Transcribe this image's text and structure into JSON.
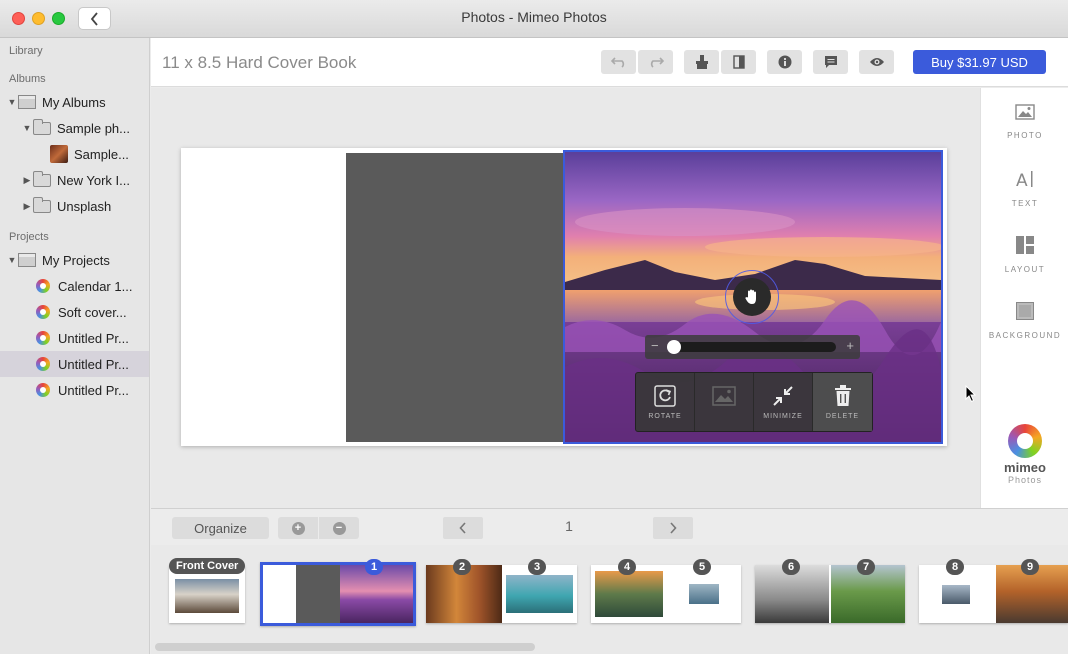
{
  "window": {
    "title": "Photos - Mimeo Photos"
  },
  "sidebar": {
    "library_heading": "Library",
    "albums_heading": "Albums",
    "albums": [
      {
        "label": "My Albums"
      },
      {
        "label": "Sample ph..."
      },
      {
        "label": "Sample..."
      },
      {
        "label": "New York I..."
      },
      {
        "label": "Unsplash"
      }
    ],
    "projects_heading": "Projects",
    "projects": [
      {
        "label": "My Projects"
      },
      {
        "label": "Calendar 1..."
      },
      {
        "label": "Soft cover..."
      },
      {
        "label": "Untitled Pr..."
      },
      {
        "label": "Untitled Pr..."
      },
      {
        "label": "Untitled Pr..."
      }
    ]
  },
  "header": {
    "book_title": "11 x 8.5 Hard Cover Book",
    "buy_label": "Buy $31.97 USD"
  },
  "photo_tools": {
    "rotate": "ROTATE",
    "minimize": "MINIMIZE",
    "delete": "DELETE",
    "zoom_level": 0
  },
  "right_panel": {
    "photo": "PHOTO",
    "text": "TEXT",
    "layout": "LAYOUT",
    "background": "BACKGROUND",
    "logo_text": "mimeo",
    "logo_sub": "Photos"
  },
  "bottom": {
    "organize": "Organize",
    "page_number": "1"
  },
  "thumbnails": {
    "front_cover": "Front Cover",
    "pages": [
      "1",
      "2",
      "3",
      "4",
      "5",
      "6",
      "7",
      "8",
      "9"
    ]
  },
  "colors": {
    "accent": "#3b5bdb"
  }
}
